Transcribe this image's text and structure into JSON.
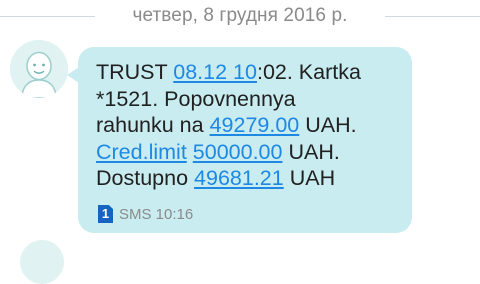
{
  "date_separator": "четвер, 8 грудня 2016 р.",
  "message": {
    "sender": "TRUST",
    "link_datetime": "08.12 10",
    "after_datetime": ":02. Kartka",
    "line2": "*1521. Popovnennya",
    "line3_prefix": "rahunku na",
    "amount_topup": "49279.00",
    "currency_1": "UAH.",
    "cred_limit_label": "Cred.limit",
    "amount_limit": "50000.00",
    "currency_2": "UAH.",
    "available_label": "Dostupno",
    "amount_available": "49681.21",
    "currency_3": "UAH"
  },
  "meta": {
    "sim_slot": "1",
    "sms_time": "SMS 10:16"
  },
  "colors": {
    "bubble": "#c8ecf0",
    "link": "#1e88e5",
    "sim_badge": "#1565c0"
  },
  "icons": {
    "avatar": "person-avatar-icon",
    "sim": "sim-card-icon"
  }
}
